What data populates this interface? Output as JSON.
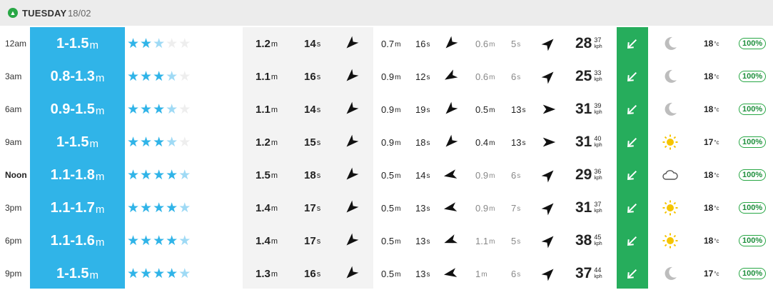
{
  "header": {
    "toggle_icon": "chevron-up-icon",
    "day": "TUESDAY",
    "date": "18/02"
  },
  "units": {
    "m": "m",
    "s": "s",
    "kph": "kph",
    "c": "°c"
  },
  "rows": [
    {
      "time": "12am",
      "surf": "1-1.5",
      "stars": 2,
      "light_stars": 1,
      "p_height": "1.2",
      "p_period": "14",
      "p_dir": 225,
      "s1_height": "0.7",
      "s1_period": "16",
      "s1_dir": 225,
      "s2_height": "0.6",
      "s2_period": "5",
      "s2_dir": 45,
      "wind": "28",
      "gust": "37",
      "wind_dir": 45,
      "weather": "moon-icon",
      "temp": "18",
      "prob": "100%"
    },
    {
      "time": "3am",
      "surf": "0.8-1.3",
      "stars": 3,
      "light_stars": 1,
      "p_height": "1.1",
      "p_period": "16",
      "p_dir": 225,
      "s1_height": "0.9",
      "s1_period": "12",
      "s1_dir": 240,
      "s2_height": "0.6",
      "s2_period": "6",
      "s2_dir": 45,
      "wind": "25",
      "gust": "33",
      "wind_dir": 45,
      "weather": "moon-icon",
      "temp": "18",
      "prob": "100%"
    },
    {
      "time": "6am",
      "surf": "0.9-1.5",
      "stars": 3,
      "light_stars": 1,
      "p_height": "1.1",
      "p_period": "14",
      "p_dir": 225,
      "s1_height": "0.9",
      "s1_period": "19",
      "s1_dir": 225,
      "s2_height": "0.5",
      "s2_period": "13",
      "s2_dir": 90,
      "wind": "31",
      "gust": "39",
      "wind_dir": 45,
      "weather": "moon-icon",
      "temp": "18",
      "prob": "100%"
    },
    {
      "time": "9am",
      "surf": "1-1.5",
      "stars": 3,
      "light_stars": 1,
      "p_height": "1.2",
      "p_period": "15",
      "p_dir": 225,
      "s1_height": "0.9",
      "s1_period": "18",
      "s1_dir": 225,
      "s2_height": "0.4",
      "s2_period": "13",
      "s2_dir": 90,
      "wind": "31",
      "gust": "40",
      "wind_dir": 45,
      "weather": "sun-icon",
      "temp": "17",
      "prob": "100%"
    },
    {
      "time": "Noon",
      "surf": "1.1-1.8",
      "stars": 4,
      "light_stars": 1,
      "p_height": "1.5",
      "p_period": "18",
      "p_dir": 225,
      "s1_height": "0.5",
      "s1_period": "14",
      "s1_dir": 260,
      "s2_height": "0.9",
      "s2_period": "6",
      "s2_dir": 45,
      "wind": "29",
      "gust": "36",
      "wind_dir": 45,
      "weather": "cloud-icon",
      "temp": "18",
      "prob": "100%"
    },
    {
      "time": "3pm",
      "surf": "1.1-1.7",
      "stars": 4,
      "light_stars": 1,
      "p_height": "1.4",
      "p_period": "17",
      "p_dir": 225,
      "s1_height": "0.5",
      "s1_period": "13",
      "s1_dir": 260,
      "s2_height": "0.9",
      "s2_period": "7",
      "s2_dir": 45,
      "wind": "31",
      "gust": "37",
      "wind_dir": 45,
      "weather": "sun-icon",
      "temp": "18",
      "prob": "100%"
    },
    {
      "time": "6pm",
      "surf": "1.1-1.6",
      "stars": 4,
      "light_stars": 1,
      "p_height": "1.4",
      "p_period": "17",
      "p_dir": 225,
      "s1_height": "0.5",
      "s1_period": "13",
      "s1_dir": 250,
      "s2_height": "1.1",
      "s2_period": "5",
      "s2_dir": 45,
      "wind": "38",
      "gust": "45",
      "wind_dir": 45,
      "weather": "sun-icon",
      "temp": "18",
      "prob": "100%"
    },
    {
      "time": "9pm",
      "surf": "1-1.5",
      "stars": 4,
      "light_stars": 1,
      "p_height": "1.3",
      "p_period": "16",
      "p_dir": 225,
      "s1_height": "0.5",
      "s1_period": "13",
      "s1_dir": 260,
      "s2_height": "1",
      "s2_period": "6",
      "s2_dir": 45,
      "wind": "37",
      "gust": "44",
      "wind_dir": 45,
      "weather": "moon-icon",
      "temp": "17",
      "prob": "100%"
    }
  ],
  "colors": {
    "surf_bg": "#30b4e8",
    "wind_dir_bg": "#26ad5c",
    "primary_bg": "#f3f3f3",
    "prob_green": "#28a745"
  }
}
